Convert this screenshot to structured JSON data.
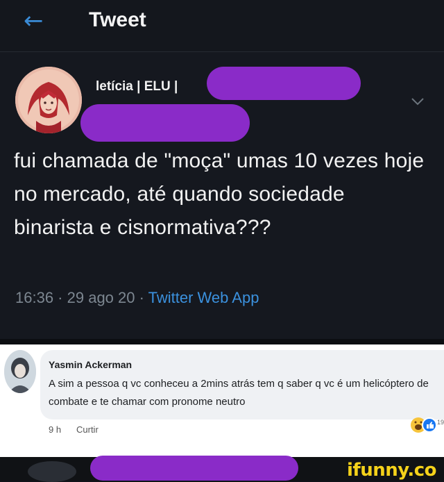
{
  "header": {
    "back_icon": "arrow-left-icon",
    "title": "Tweet"
  },
  "tweet": {
    "author_name": "letícia | ELU |",
    "text": "fui chamada de \"moça\" umas 10 vezes hoje no mercado, até quando sociedade binarista e cisnormativa???",
    "time": "16:36",
    "date": "29 ago 20",
    "separator": " · ",
    "source": "Twitter Web App",
    "colors": {
      "accent": "#3b91de",
      "redaction": "#8a2bc8"
    }
  },
  "comment": {
    "author": "Yasmin Ackerman",
    "text": "A sim a pessoa q vc conheceu a 2mins atrás tem q saber q vc é um helicóptero de combate e te chamar com pronome neutro",
    "time": "9 h",
    "like_label": "Curtir",
    "reaction_count": "19"
  },
  "watermark": {
    "text": "ifunny.co"
  }
}
